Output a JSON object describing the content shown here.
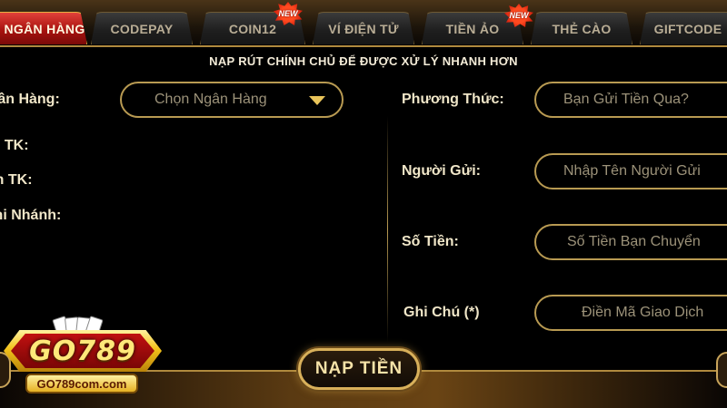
{
  "tabs": [
    {
      "label": "NGÂN HÀNG",
      "active": true,
      "new": false
    },
    {
      "label": "CODEPAY",
      "active": false,
      "new": false
    },
    {
      "label": "COIN12",
      "active": false,
      "new": true
    },
    {
      "label": "VÍ ĐIỆN TỬ",
      "active": false,
      "new": false
    },
    {
      "label": "TIỀN ẢO",
      "active": false,
      "new": true
    },
    {
      "label": "THẺ CÀO",
      "active": false,
      "new": false
    },
    {
      "label": "GIFTCODE",
      "active": false,
      "new": false
    }
  ],
  "badge_label": "NEW",
  "notice": "NẠP RÚT CHÍNH CHỦ ĐỂ ĐƯỢC XỬ LÝ NHANH HƠN",
  "left_form": {
    "bank_label": "Ngân Hàng:",
    "bank_select_placeholder": "Chọn Ngân Hàng",
    "account_number_label": "Số TK:",
    "account_name_label": "Tên TK:",
    "branch_label": "Chi Nhánh:"
  },
  "right_form": {
    "method_label": "Phương Thức:",
    "method_placeholder": "Bạn Gửi Tiền Qua?",
    "sender_label": "Người Gửi:",
    "sender_placeholder": "Nhập Tên Người Gửi",
    "amount_label": "Số Tiền:",
    "amount_placeholder": "Số Tiền Bạn Chuyển",
    "note_label": "Ghi Chú (*)",
    "note_placeholder": "Điền Mã Giao Dịch"
  },
  "deposit_button": "NẠP TIỀN",
  "logo": {
    "brand": "GO789",
    "domain": "GO789com.com"
  },
  "colors": {
    "accent_gold": "#d8b05a",
    "active_tab_red": "#c01a14",
    "background": "#000000"
  }
}
